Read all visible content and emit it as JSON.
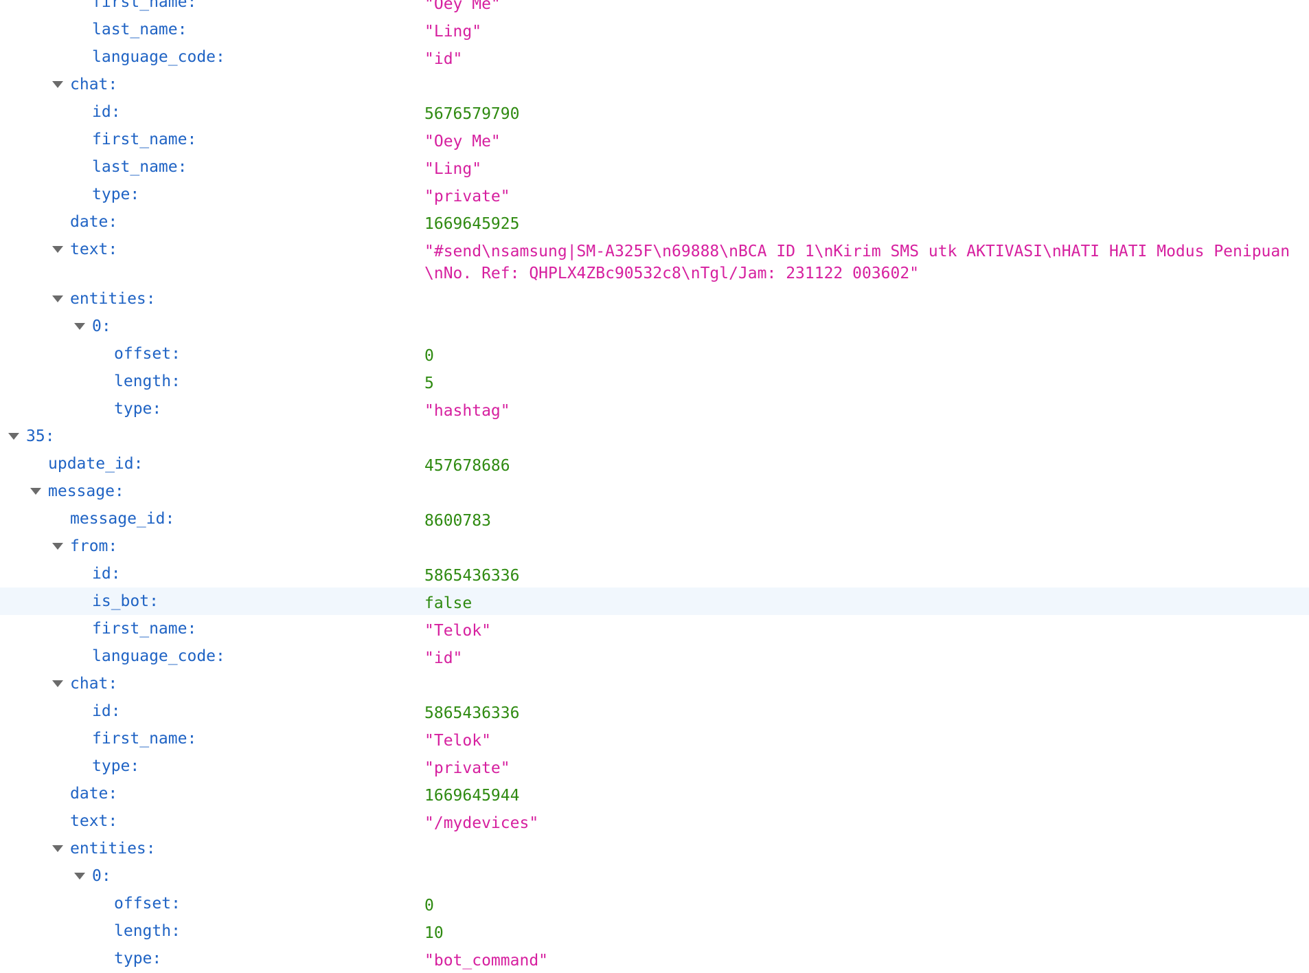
{
  "rows": [
    {
      "key": "first_name:",
      "value": "\"Oey Me\"",
      "type": "string"
    },
    {
      "key": "last_name:",
      "value": "\"Ling\"",
      "type": "string"
    },
    {
      "key": "language_code:",
      "value": "\"id\"",
      "type": "string"
    },
    {
      "key": "chat:",
      "expandable": true
    },
    {
      "key": "id:",
      "value": "5676579790",
      "type": "number"
    },
    {
      "key": "first_name:",
      "value": "\"Oey Me\"",
      "type": "string"
    },
    {
      "key": "last_name:",
      "value": "\"Ling\"",
      "type": "string"
    },
    {
      "key": "type:",
      "value": "\"private\"",
      "type": "string"
    },
    {
      "key": "date:",
      "value": "1669645925",
      "type": "number"
    },
    {
      "key": "text:",
      "expandable": true,
      "value": "\"#send\\nsamsung|SM-A325F\\n69888\\nBCA ID 1\\nKirim SMS utk AKTIVASI\\nHATI HATI Modus Penipuan\\nNo. Ref: QHPLX4ZBc90532c8\\nTgl/Jam: 231122 003602\"",
      "type": "string"
    },
    {
      "key": "entities:",
      "expandable": true
    },
    {
      "key": "0:",
      "expandable": true
    },
    {
      "key": "offset:",
      "value": "0",
      "type": "number"
    },
    {
      "key": "length:",
      "value": "5",
      "type": "number"
    },
    {
      "key": "type:",
      "value": "\"hashtag\"",
      "type": "string"
    },
    {
      "key": "35:",
      "expandable": true
    },
    {
      "key": "update_id:",
      "value": "457678686",
      "type": "number"
    },
    {
      "key": "message:",
      "expandable": true
    },
    {
      "key": "message_id:",
      "value": "8600783",
      "type": "number"
    },
    {
      "key": "from:",
      "expandable": true
    },
    {
      "key": "id:",
      "value": "5865436336",
      "type": "number"
    },
    {
      "key": "is_bot:",
      "value": "false",
      "type": "boolean"
    },
    {
      "key": "first_name:",
      "value": "\"Telok\"",
      "type": "string"
    },
    {
      "key": "language_code:",
      "value": "\"id\"",
      "type": "string"
    },
    {
      "key": "chat:",
      "expandable": true
    },
    {
      "key": "id:",
      "value": "5865436336",
      "type": "number"
    },
    {
      "key": "first_name:",
      "value": "\"Telok\"",
      "type": "string"
    },
    {
      "key": "type:",
      "value": "\"private\"",
      "type": "string"
    },
    {
      "key": "date:",
      "value": "1669645944",
      "type": "number"
    },
    {
      "key": "text:",
      "value": "\"/mydevices\"",
      "type": "string"
    },
    {
      "key": "entities:",
      "expandable": true
    },
    {
      "key": "0:",
      "expandable": true
    },
    {
      "key": "offset:",
      "value": "0",
      "type": "number"
    },
    {
      "key": "length:",
      "value": "10",
      "type": "number"
    },
    {
      "key": "type:",
      "value": "\"bot_command\"",
      "type": "string"
    }
  ],
  "icons": {
    "expander": "chevron-down-icon"
  }
}
